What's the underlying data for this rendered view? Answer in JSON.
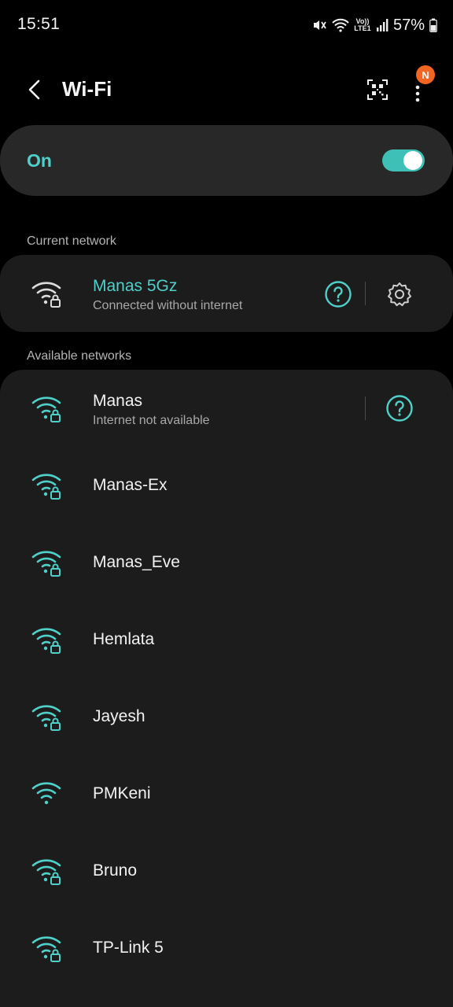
{
  "status_bar": {
    "time": "15:51",
    "volte_line1": "Vo))",
    "volte_line2": "LTE1",
    "battery": "57%"
  },
  "header": {
    "title": "Wi-Fi",
    "badge": "N"
  },
  "toggle": {
    "label": "On",
    "state": "on"
  },
  "current_section": {
    "label": "Current network",
    "network": {
      "name": "Manas 5Gz",
      "status": "Connected without internet"
    }
  },
  "available_section": {
    "label": "Available networks",
    "networks": [
      {
        "name": "Manas",
        "status": "Internet not available",
        "secured": true
      },
      {
        "name": "Manas-Ex",
        "secured": true
      },
      {
        "name": "Manas_Eve",
        "secured": true
      },
      {
        "name": "Hemlata",
        "secured": true
      },
      {
        "name": "Jayesh",
        "secured": true
      },
      {
        "name": "PMKeni",
        "secured": false
      },
      {
        "name": "Bruno",
        "secured": true
      },
      {
        "name": "TP-Link 5",
        "secured": true
      }
    ]
  },
  "colors": {
    "accent": "#4fd0c9",
    "card": "#1c1c1c",
    "background": "#000000"
  }
}
